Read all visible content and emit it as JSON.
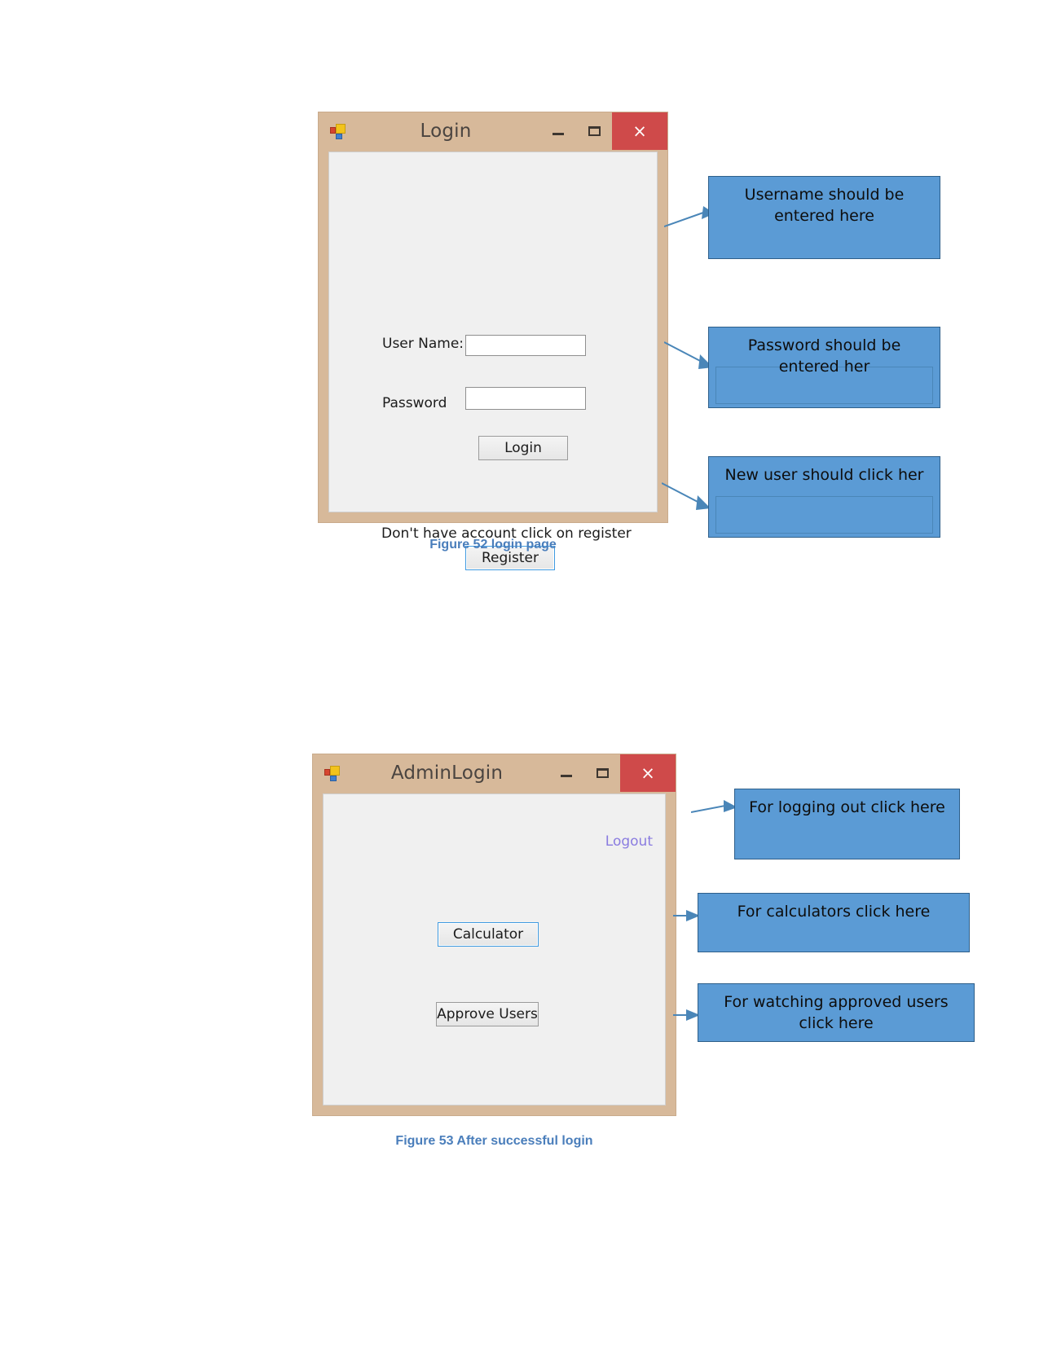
{
  "page": {
    "background": "#ffffff",
    "caption_color": "#4a7ebb",
    "callout_fill": "#5b9bd5",
    "callout_border": "#2e5f8a",
    "titlebar_color": "#d7b99a",
    "close_button_color": "#cf4a4a"
  },
  "figure1": {
    "window": {
      "title": "Login",
      "icon": "app-windows-forms-icon",
      "minimize_label": "–",
      "maximize_label": "☐",
      "close_label": "×",
      "fields": [
        {
          "label": "User Name:",
          "value": "",
          "placeholder": ""
        },
        {
          "label": "Password",
          "value": "",
          "placeholder": ""
        }
      ],
      "login_button": "Login",
      "register_hint": "Don't have account click on register",
      "register_button": "Register"
    },
    "callouts": [
      {
        "text": "Username should be entered here",
        "has_inner_box": false
      },
      {
        "text": "Password should be entered her",
        "has_inner_box": true
      },
      {
        "text": "New user should click her",
        "has_inner_box": true
      }
    ],
    "caption": "Figure 52 login page"
  },
  "figure2": {
    "window": {
      "title": "AdminLogin",
      "icon": "app-windows-forms-icon",
      "minimize_label": "–",
      "maximize_label": "☐",
      "close_label": "×",
      "logout_link": "Logout",
      "calculator_button": "Calculator",
      "approve_users_button": "Approve Users"
    },
    "callouts": [
      {
        "text": "For logging out click here",
        "has_inner_box": false
      },
      {
        "text": "For calculators click here",
        "has_inner_box": false
      },
      {
        "text": "For watching approved users click here",
        "has_inner_box": false
      }
    ],
    "caption": "Figure 53 After successful login"
  }
}
